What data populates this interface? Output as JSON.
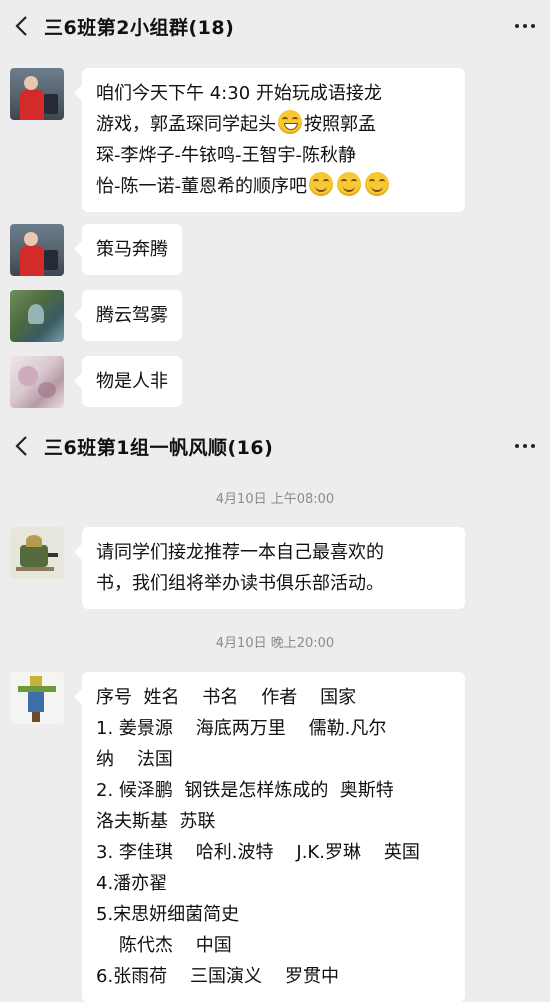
{
  "chat1": {
    "title": "三6班第2小组群(18)",
    "messages": [
      {
        "lines": [
          "咱们今天下午 4:30 开始玩成语接龙",
          "游戏，郭孟琛同学起头",
          "按照郭孟",
          "琛-李烨子-牛铱鸣-王智宇-陈秋静",
          "怡-陈一诺-董恩希的顺序吧"
        ]
      },
      {
        "text": "策马奔腾"
      },
      {
        "text": "腾云驾雾"
      },
      {
        "text": "物是人非"
      }
    ]
  },
  "chat2": {
    "title": "三6班第1组一帆风顺(16)",
    "time1": "4月10日 上午08:00",
    "msg1_lines": [
      "请同学们接龙推荐一本自己最喜欢的",
      "书，我们组将举办读书俱乐部活动。"
    ],
    "time2": "4月10日 晚上20:00",
    "msg2_lines": [
      "序号  姓名    书名    作者    国家",
      "1. 姜景源    海底两万里    儒勒.凡尔",
      "纳    法国",
      "2. 候泽鹏  钢铁是怎样炼成的  奥斯特",
      "洛夫斯基  苏联",
      "3. 李佳琪    哈利.波特    J.K.罗琳    英国",
      "4.潘亦翟",
      "5.宋思妍细菌简史",
      "    陈代杰    中国",
      "6.张雨荷    三国演义    罗贯中"
    ]
  },
  "icons": [
    "back-icon",
    "more-icon",
    "smile-emoji",
    "grin-emoji"
  ],
  "colors": {
    "background": "#ededed",
    "bubble": "#ffffff",
    "time_text": "#8c8c8c"
  }
}
